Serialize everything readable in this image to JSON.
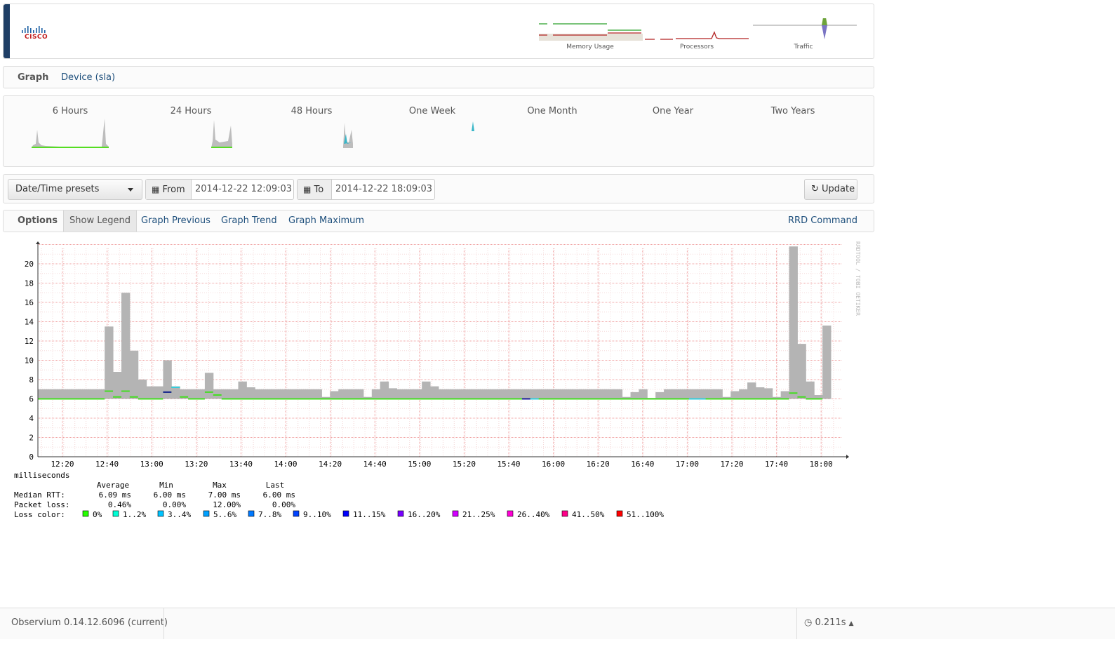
{
  "header": {
    "logo_text": "CISCO",
    "mini_graphs": [
      {
        "label": "Memory Usage"
      },
      {
        "label": "Processors"
      },
      {
        "label": "Traffic"
      }
    ]
  },
  "tabs": {
    "graph": "Graph",
    "device": "Device (sla)"
  },
  "periods": [
    "6 Hours",
    "24 Hours",
    "48 Hours",
    "One Week",
    "One Month",
    "One Year",
    "Two Years"
  ],
  "datebar": {
    "presets_label": "Date/Time presets",
    "from_label": "From",
    "from_value": "2014-12-22 12:09:03",
    "to_label": "To",
    "to_value": "2014-12-22 18:09:03",
    "update_label": "Update"
  },
  "options_bar": {
    "options": "Options",
    "show_legend": "Show Legend",
    "graph_previous": "Graph Previous",
    "graph_trend": "Graph Trend",
    "graph_maximum": "Graph Maximum",
    "rrd_command": "RRD Command"
  },
  "chart_data": {
    "type": "area",
    "unit_label": "milliseconds",
    "watermark": "RRDTOOL / TOBI OETIKER",
    "ylim": [
      0,
      22
    ],
    "y_ticks": [
      0,
      2,
      4,
      6,
      8,
      10,
      12,
      14,
      16,
      18,
      20
    ],
    "x_ticks": [
      "12:20",
      "12:40",
      "13:00",
      "13:20",
      "13:40",
      "14:00",
      "14:20",
      "14:40",
      "15:00",
      "15:20",
      "15:40",
      "16:00",
      "16:20",
      "16:40",
      "17:00",
      "17:20",
      "17:40",
      "18:00"
    ],
    "x_range_minutes": [
      0,
      360
    ],
    "series": [
      {
        "kind": "max_ping_range",
        "points": [
          [
            0,
            7
          ],
          [
            5,
            7
          ],
          [
            10,
            7
          ],
          [
            15,
            7
          ],
          [
            20,
            7
          ],
          [
            25,
            7
          ],
          [
            30,
            7
          ],
          [
            35,
            7
          ],
          [
            40,
            13.5
          ],
          [
            45,
            8.8
          ],
          [
            50,
            17
          ],
          [
            55,
            11
          ],
          [
            60,
            8
          ],
          [
            65,
            7.3
          ],
          [
            70,
            7.3
          ],
          [
            75,
            10
          ],
          [
            80,
            7.3
          ],
          [
            85,
            7
          ],
          [
            90,
            7
          ],
          [
            95,
            7
          ],
          [
            100,
            8.7
          ],
          [
            105,
            7
          ],
          [
            110,
            7
          ],
          [
            115,
            7
          ],
          [
            120,
            7.8
          ],
          [
            125,
            7.2
          ],
          [
            130,
            7
          ],
          [
            135,
            7
          ],
          [
            140,
            7
          ],
          [
            145,
            7
          ],
          [
            150,
            7
          ],
          [
            155,
            7
          ],
          [
            160,
            7
          ],
          [
            165,
            7
          ],
          [
            170,
            6.2
          ],
          [
            175,
            6.8
          ],
          [
            180,
            7
          ],
          [
            185,
            7
          ],
          [
            190,
            7
          ],
          [
            195,
            6.2
          ],
          [
            200,
            7
          ],
          [
            205,
            7.8
          ],
          [
            210,
            7.1
          ],
          [
            215,
            7
          ],
          [
            220,
            7
          ],
          [
            225,
            7
          ],
          [
            230,
            7.8
          ],
          [
            235,
            7.3
          ],
          [
            240,
            7
          ],
          [
            245,
            7
          ],
          [
            250,
            7
          ],
          [
            255,
            7
          ],
          [
            260,
            7
          ],
          [
            265,
            7
          ],
          [
            270,
            7
          ],
          [
            275,
            7
          ],
          [
            280,
            7
          ],
          [
            285,
            7
          ],
          [
            290,
            7
          ],
          [
            295,
            7
          ],
          [
            300,
            7
          ],
          [
            305,
            7
          ],
          [
            310,
            7
          ],
          [
            315,
            7
          ],
          [
            320,
            7
          ],
          [
            325,
            7
          ],
          [
            330,
            7
          ],
          [
            335,
            7
          ],
          [
            340,
            7
          ],
          [
            345,
            7
          ],
          [
            350,
            6.2
          ],
          [
            355,
            6.7
          ],
          [
            360,
            7
          ],
          [
            365,
            6.1
          ],
          [
            370,
            6.7
          ],
          [
            375,
            7
          ],
          [
            380,
            7
          ],
          [
            385,
            7
          ],
          [
            390,
            7
          ],
          [
            395,
            7
          ],
          [
            400,
            7
          ],
          [
            405,
            7
          ],
          [
            410,
            6.2
          ],
          [
            415,
            6.8
          ],
          [
            420,
            7
          ],
          [
            425,
            7.7
          ],
          [
            430,
            7.2
          ],
          [
            435,
            7.1
          ],
          [
            440,
            6.2
          ],
          [
            445,
            6.8
          ],
          [
            450,
            21.8
          ],
          [
            455,
            11.7
          ],
          [
            460,
            7.8
          ],
          [
            465,
            6.4
          ],
          [
            470,
            13.6
          ]
        ]
      },
      {
        "kind": "median_rtt",
        "points": [
          [
            0,
            6
          ],
          [
            40,
            6.8
          ],
          [
            45,
            6.2
          ],
          [
            50,
            6.8
          ],
          [
            55,
            6.2
          ],
          [
            60,
            6
          ],
          [
            75,
            6.7
          ],
          [
            80,
            7.2
          ],
          [
            85,
            6.2
          ],
          [
            90,
            6
          ],
          [
            95,
            6
          ],
          [
            100,
            6.7
          ],
          [
            105,
            6.4
          ],
          [
            110,
            6
          ],
          [
            360,
            6
          ],
          [
            450,
            6.6
          ],
          [
            455,
            6.2
          ],
          [
            460,
            6
          ],
          [
            470,
            6
          ]
        ]
      }
    ],
    "legend": {
      "columns": [
        "Average",
        "Min",
        "Max",
        "Last"
      ],
      "rows": [
        {
          "label": "Median RTT:",
          "values": [
            "6.09 ms",
            "6.00 ms",
            "7.00 ms",
            "6.00 ms"
          ]
        },
        {
          "label": "Packet loss:",
          "values": [
            "0.46%",
            "0.00%",
            "12.00%",
            "0.00%"
          ]
        }
      ],
      "loss_color_label": "Loss color:",
      "loss_colors": [
        {
          "label": "0%",
          "color": "#26ff00"
        },
        {
          "label": "1..2%",
          "color": "#00ffd5"
        },
        {
          "label": "3..4%",
          "color": "#00c3ff"
        },
        {
          "label": "5..6%",
          "color": "#00a0ff"
        },
        {
          "label": "7..8%",
          "color": "#0079ff"
        },
        {
          "label": "9..10%",
          "color": "#0043ff"
        },
        {
          "label": "11..15%",
          "color": "#0000ff"
        },
        {
          "label": "16..20%",
          "color": "#7700ff"
        },
        {
          "label": "21..25%",
          "color": "#d200ff"
        },
        {
          "label": "26..40%",
          "color": "#ff00d5"
        },
        {
          "label": "41..50%",
          "color": "#ff0088"
        },
        {
          "label": "51..100%",
          "color": "#ff0000"
        }
      ]
    }
  },
  "footer": {
    "version": "Observium 0.14.12.6096 (current)",
    "timing": "0.211s"
  }
}
